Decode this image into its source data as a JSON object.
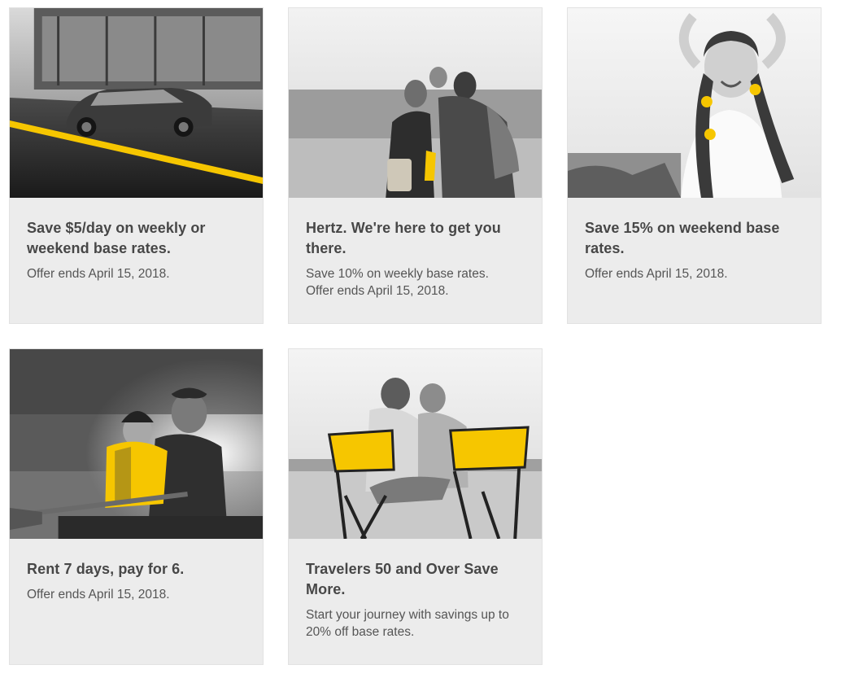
{
  "colors": {
    "accent_yellow": "#f6c600",
    "card_background": "#ececec",
    "heading_text": "#474747",
    "body_text": "#555555"
  },
  "offers": [
    {
      "image": "sedan-on-road-photo",
      "title": "Save $5/day on weekly or weekend base rates.",
      "lines": [
        "Offer ends April 15, 2018."
      ]
    },
    {
      "image": "family-on-beach-photo",
      "title": "Hertz. We're here to get you there.",
      "lines": [
        "Save 10% on weekly base rates.",
        "Offer ends April 15, 2018."
      ]
    },
    {
      "image": "smiling-girl-photo",
      "title": "Save 15% on weekend base rates.",
      "lines": [
        "Offer ends April 15, 2018."
      ]
    },
    {
      "image": "father-son-kayak-photo",
      "title": "Rent 7 days, pay for 6.",
      "lines": [
        "Offer ends April 15, 2018."
      ]
    },
    {
      "image": "couple-beach-chairs-photo",
      "title": "Travelers 50 and Over Save More.",
      "lines": [
        "Start your journey with savings up to 20% off base rates."
      ]
    }
  ]
}
